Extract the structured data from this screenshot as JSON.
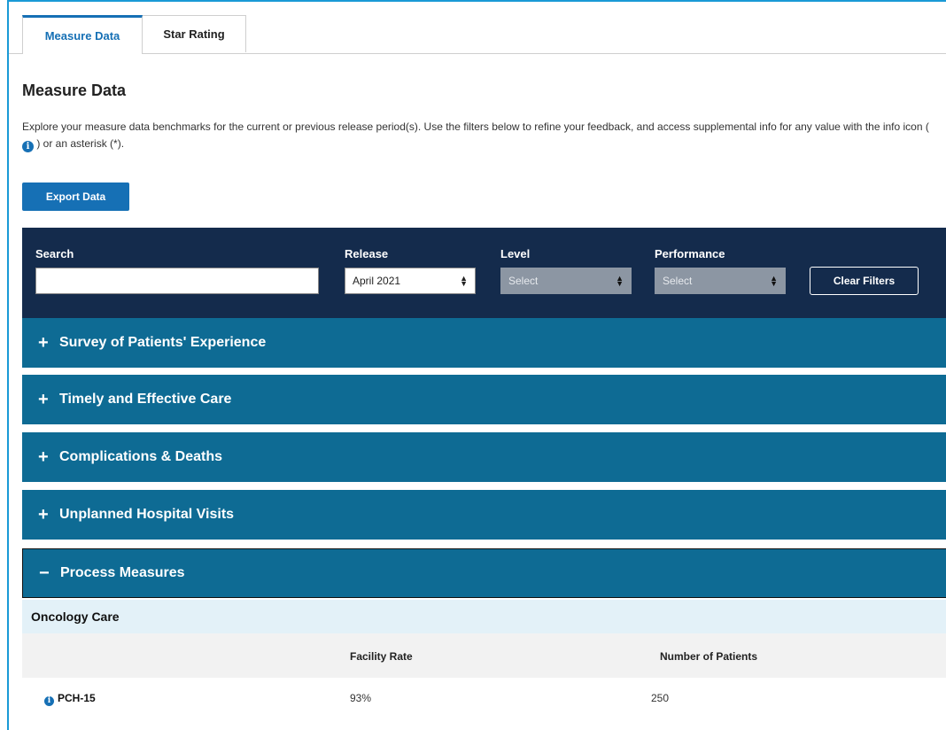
{
  "tabs": [
    {
      "label": "Measure Data",
      "active": true
    },
    {
      "label": "Star Rating",
      "active": false
    }
  ],
  "page": {
    "title": "Measure Data",
    "description_part1": "Explore your measure data benchmarks for the current or previous release period(s). Use the filters below to refine your feedback, and access supplemental info for any value with the info icon (",
    "description_part2": ") or an asterisk (*).",
    "info_glyph": "i",
    "export_label": "Export Data"
  },
  "filters": {
    "search_label": "Search",
    "search_value": "",
    "release_label": "Release",
    "release_value": "April 2021",
    "level_label": "Level",
    "level_value": "Select",
    "performance_label": "Performance",
    "performance_value": "Select",
    "clear_label": "Clear Filters"
  },
  "accordions": [
    {
      "sign": "+",
      "label": "Survey of Patients' Experience"
    },
    {
      "sign": "+",
      "label": "Timely and Effective Care"
    },
    {
      "sign": "+",
      "label": "Complications & Deaths"
    },
    {
      "sign": "+",
      "label": "Unplanned Hospital Visits"
    },
    {
      "sign": "−",
      "label": "Process Measures"
    }
  ],
  "process": {
    "section_title": "Oncology Care",
    "columns": [
      "",
      "Facility Rate",
      "Number of Patients"
    ],
    "rows": [
      {
        "measure": "PCH-15",
        "facility_rate": "93%",
        "patients": "250"
      }
    ]
  },
  "colors": {
    "primary": "#1670b5",
    "filter_bar": "#142b4c",
    "accordion": "#0e6b94",
    "section_bg": "#e3f1f8"
  }
}
